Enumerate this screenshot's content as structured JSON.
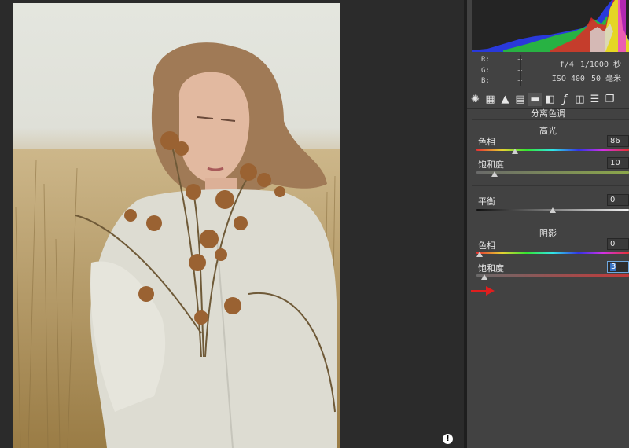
{
  "panel": {
    "info": {
      "r_label": "R:",
      "r_value": "—",
      "g_label": "G:",
      "g_value": "—",
      "b_label": "B:",
      "b_value": "—",
      "aperture": "f/4",
      "shutter": "1/1000 秒",
      "iso": "ISO 400",
      "focal": "50 毫米"
    },
    "toolbar_icons": [
      "aperture-icon",
      "grid-icon",
      "mountain-icon",
      "hsl-icon",
      "split-toning-icon",
      "lens-icon",
      "fx-icon",
      "camera-calibration-icon",
      "presets-icon",
      "snapshots-icon"
    ],
    "split_toning": {
      "title": "分离色调",
      "highlights": {
        "title": "高光",
        "hue_label": "色相",
        "hue_value": "86",
        "hue_level": 0.24,
        "saturation_label": "饱和度",
        "saturation_value": "10",
        "saturation_level": 0.1
      },
      "balance": {
        "label": "平衡",
        "value": "0",
        "level": 0.5
      },
      "shadows": {
        "title": "阴影",
        "hue_label": "色相",
        "hue_value": "0",
        "hue_level": 0.0,
        "saturation_label": "饱和度",
        "saturation_value": "3",
        "saturation_level": 0.03
      }
    }
  },
  "colors": {
    "accent": "#3872c2",
    "annotation_arrow": "#e01e1e",
    "panel_bg": "#424242",
    "canvas_bg": "#2b2b2b"
  }
}
